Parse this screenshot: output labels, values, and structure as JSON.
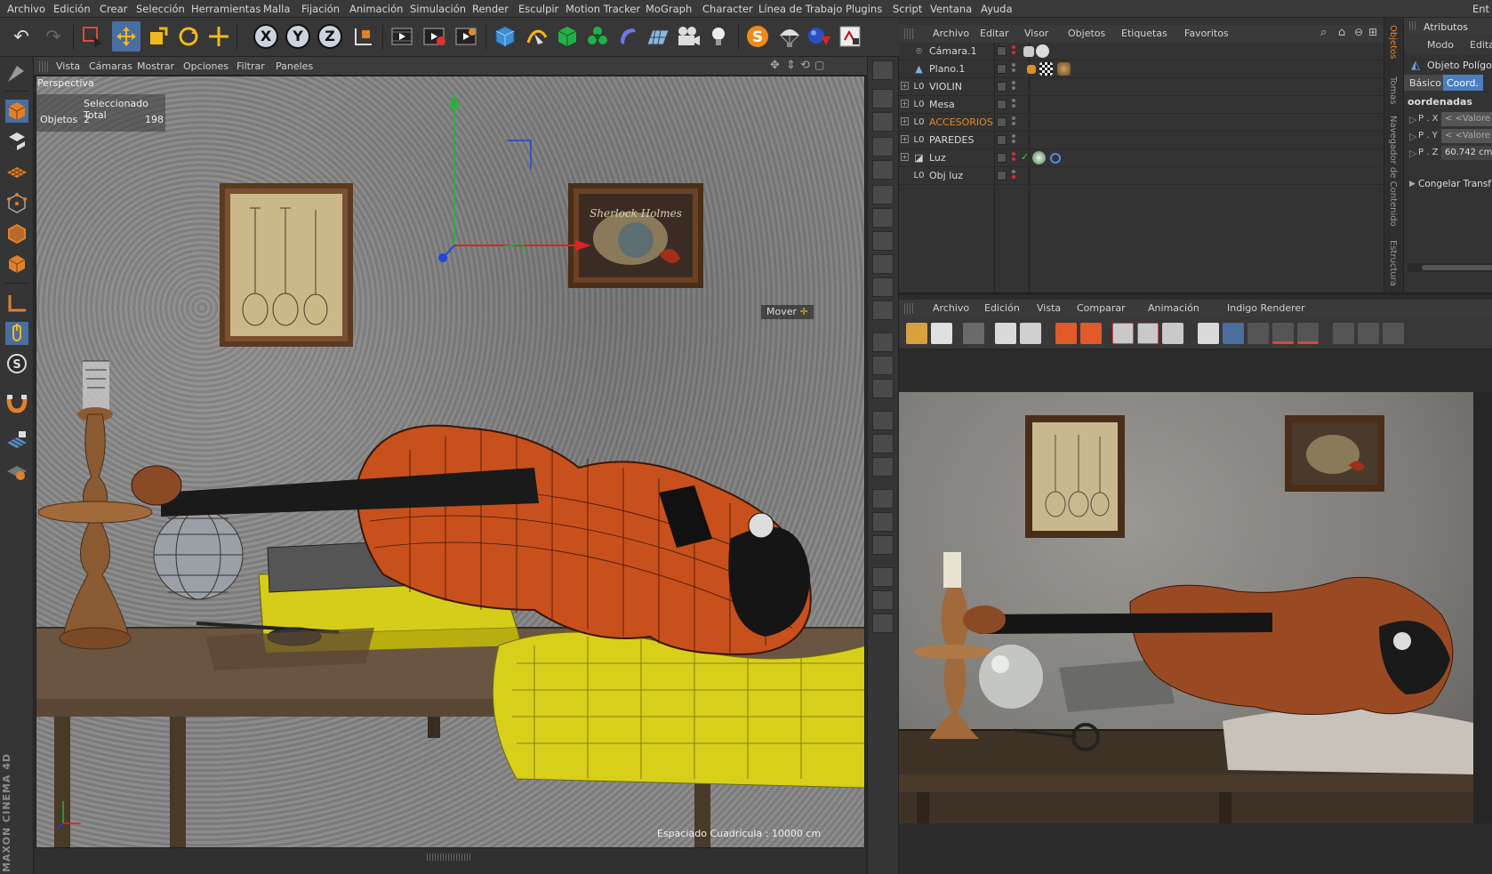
{
  "menubar": {
    "items": [
      "Archivo",
      "Edición",
      "Crear",
      "Selección",
      "Herramientas",
      "Malla",
      "Fijación",
      "Animación",
      "Simulación",
      "Render",
      "Esculpir",
      "Motion Tracker",
      "MoGraph",
      "Character",
      "Línea de Trabajo",
      "Plugins",
      "Script",
      "Ventana",
      "Ayuda",
      "Ent"
    ]
  },
  "viewport": {
    "menu": [
      "Vista",
      "Cámaras",
      "Mostrar",
      "Opciones",
      "Filtrar",
      "Paneles"
    ],
    "label": "Perspectiva",
    "stats_header": "Seleccionado Total",
    "stats_label": "Objetos",
    "stats_selected": "2",
    "stats_total": "198",
    "move_label": "Mover",
    "grid_text": "Espaciado Cuadrícula : 10000 cm"
  },
  "object_manager": {
    "menu": [
      "Archivo",
      "Editar",
      "Visor",
      "Objetos",
      "Etiquetas",
      "Favoritos"
    ],
    "objects": [
      {
        "name": "Cámara.1",
        "icon": "camera-icon",
        "expandable": false,
        "highlight": false
      },
      {
        "name": "Plano.1",
        "icon": "plane-icon",
        "expandable": false,
        "highlight": false
      },
      {
        "name": "VIOLIN",
        "icon": "null-object-icon",
        "expandable": true,
        "highlight": false
      },
      {
        "name": "Mesa",
        "icon": "null-object-icon",
        "expandable": true,
        "highlight": false
      },
      {
        "name": "ACCESORIOS",
        "icon": "null-object-icon",
        "expandable": true,
        "highlight": true
      },
      {
        "name": "PAREDES",
        "icon": "null-object-icon",
        "expandable": true,
        "highlight": false
      },
      {
        "name": "Luz",
        "icon": "light-icon",
        "expandable": true,
        "highlight": false
      },
      {
        "name": "Obj luz",
        "icon": "null-object-icon",
        "expandable": false,
        "highlight": false
      }
    ],
    "side_tabs": [
      "Objetos",
      "Tomas",
      "Navegador de Contenido",
      "Estructura"
    ]
  },
  "attributes": {
    "title": "Atributos",
    "mode": "Modo",
    "edit": "Edita",
    "object": "Objeto Polígo",
    "tab_basic": "Básico",
    "tab_coord": "Coord.",
    "section": "oordenadas",
    "px_label": "P . X",
    "px_value": "< <Valore",
    "py_label": "P . Y",
    "py_value": "< <Valore",
    "pz_label": "P . Z",
    "pz_value": "60.742 cm",
    "freeze": "Congelar Transf"
  },
  "render_panel": {
    "menu": [
      "Archivo",
      "Edición",
      "Vista",
      "Comparar",
      "Animación",
      "Indigo Renderer"
    ]
  },
  "colors": {
    "accent_orange": "#e08a2c",
    "violin": "#c8501c",
    "yellow": "#d6cc1a",
    "highlight_tab": "#4a7fc0"
  }
}
